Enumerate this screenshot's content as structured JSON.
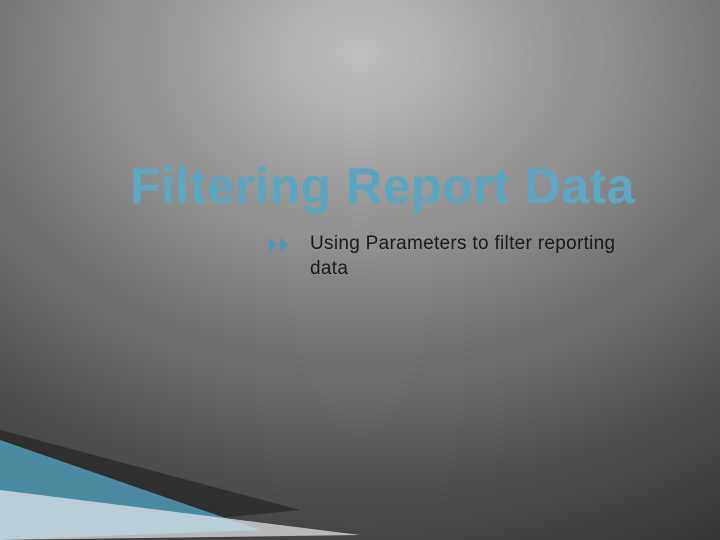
{
  "slide": {
    "title": "Filtering Report Data",
    "subtitle": "Using Parameters to filter reporting data",
    "bullet_icon_name": "double-chevron-right-icon",
    "accent_color": "#5aa7bf",
    "wedge_color_primary": "#4f96af",
    "wedge_color_secondary": "#2b2b2b"
  }
}
